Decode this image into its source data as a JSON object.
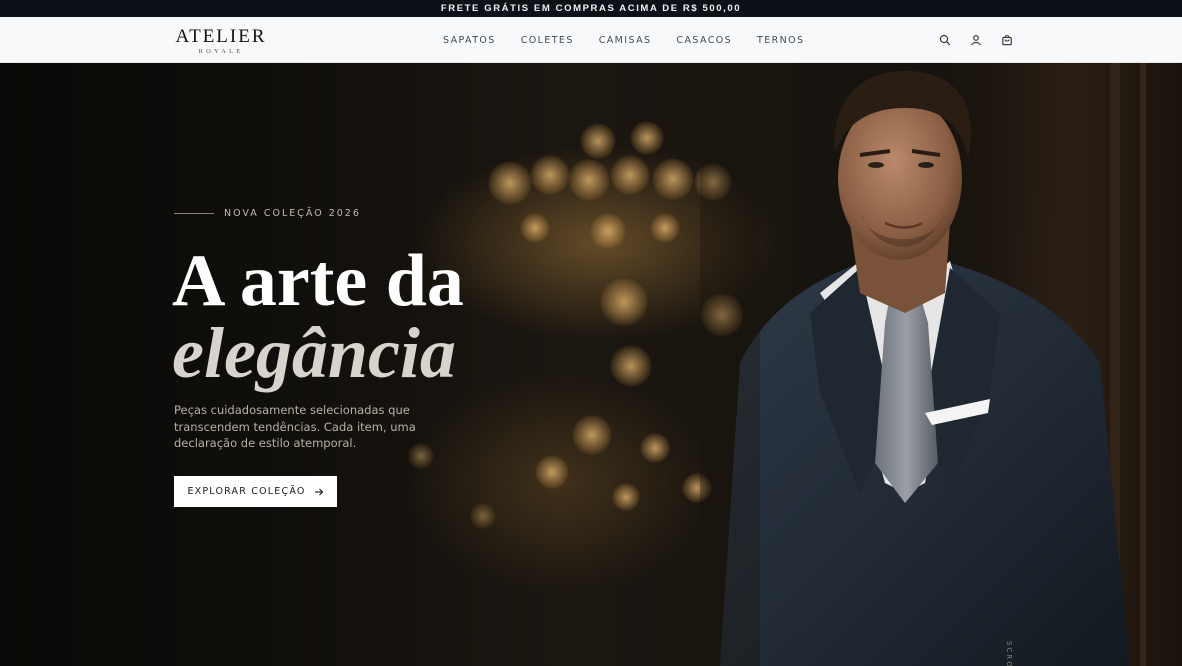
{
  "announcement": "FRETE GRÁTIS EM COMPRAS ACIMA DE R$ 500,00",
  "logo": {
    "main": "ATELIER",
    "sub": "ROYALE"
  },
  "nav": [
    "SAPATOS",
    "COLETES",
    "CAMISAS",
    "CASACOS",
    "TERNOS"
  ],
  "header_icons": [
    "search-icon",
    "user-icon",
    "cart-icon"
  ],
  "hero": {
    "eyebrow": "NOVA COLEÇÃO 2026",
    "headline_line1": "A arte da",
    "headline_line2": "elegância",
    "tagline": "Peças cuidadosamente selecionadas que transcendem tendências. Cada item, uma declaração de estilo atemporal.",
    "cta_label": "EXPLORAR COLEÇÃO",
    "scroll_hint": "SCRO"
  },
  "colors": {
    "topbar": "#0d1117",
    "header_bg": "#f7f9fb",
    "hero_bg": "#0d0c0a",
    "cta_bg": "#ffffff",
    "headline": "#ffffff",
    "headline_italic": "#d7d3cd"
  }
}
